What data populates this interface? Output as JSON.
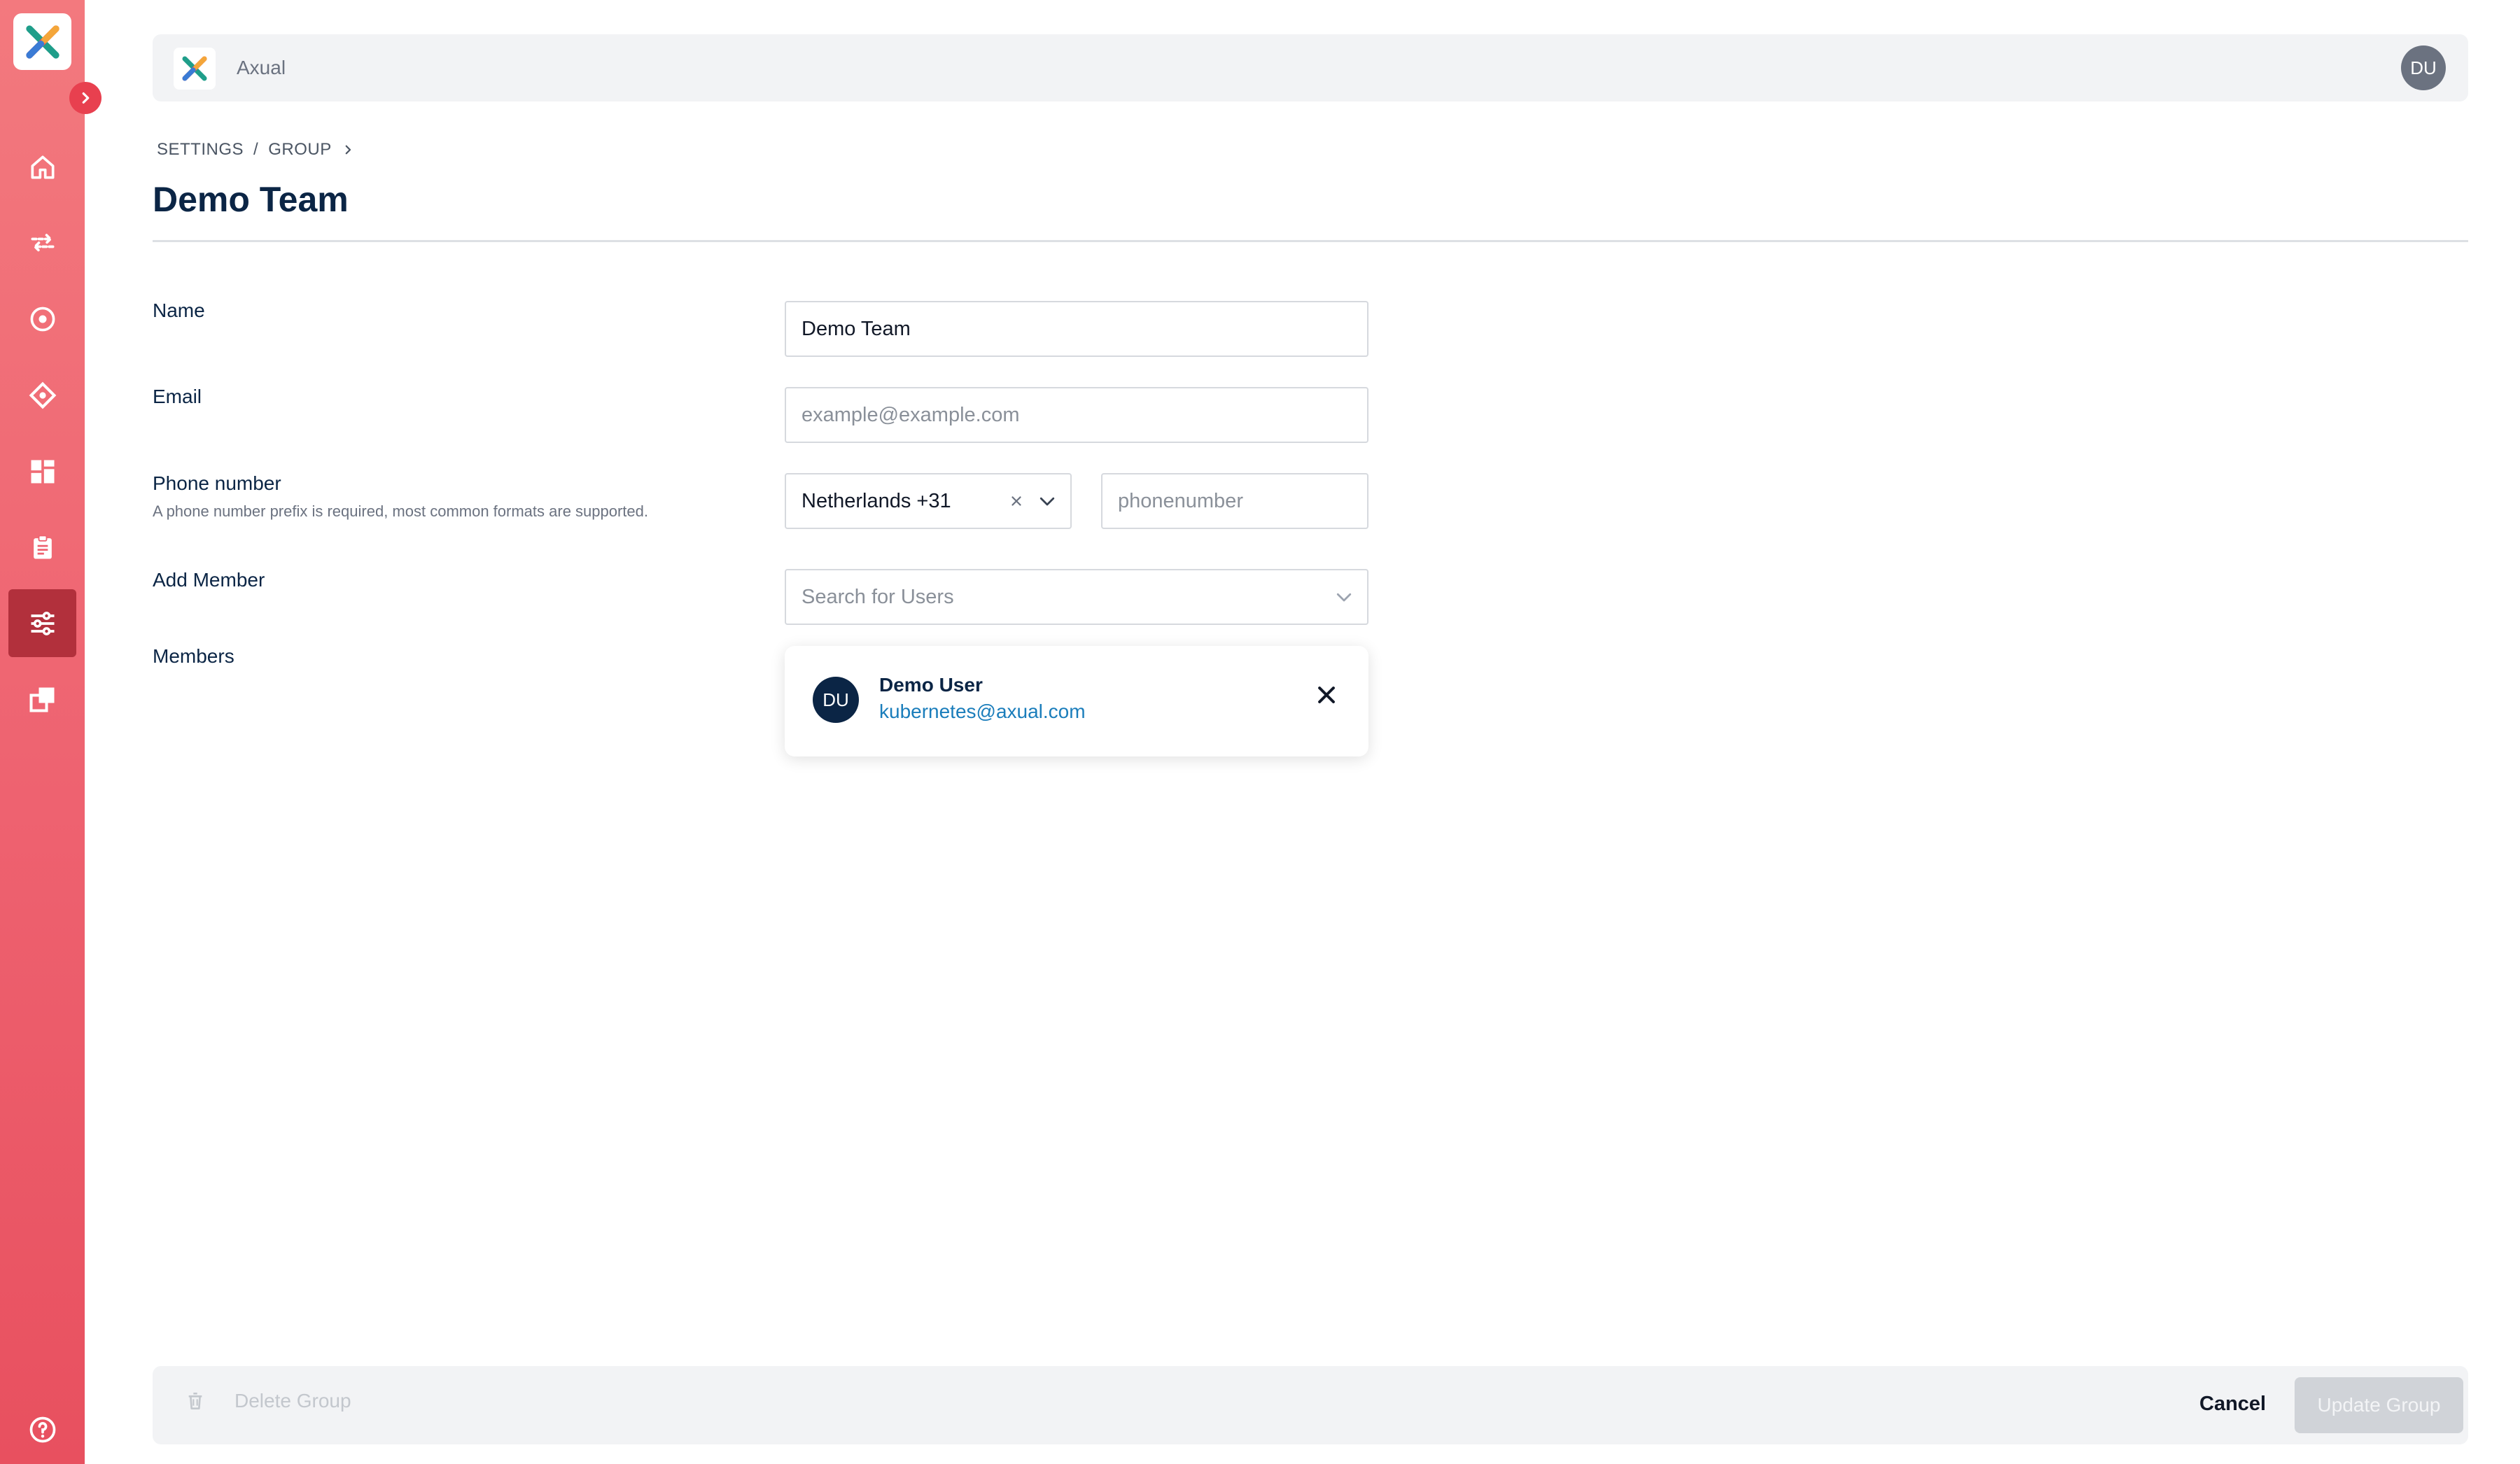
{
  "app": {
    "name": "Axual",
    "user_initials": "DU"
  },
  "breadcrumb": {
    "items": [
      "SETTINGS",
      "GROUP"
    ],
    "separator": "/"
  },
  "page": {
    "title": "Demo Team"
  },
  "form": {
    "name": {
      "label": "Name",
      "value": "Demo Team"
    },
    "email": {
      "label": "Email",
      "placeholder": "example@example.com"
    },
    "phone": {
      "label": "Phone number",
      "hint": "A phone number prefix is required, most common formats are supported.",
      "country_value": "Netherlands +31",
      "number_placeholder": "phonenumber"
    },
    "add_member": {
      "label": "Add Member",
      "placeholder": "Search for Users"
    },
    "members": {
      "label": "Members",
      "items": [
        {
          "initials": "DU",
          "name": "Demo User",
          "email": "kubernetes@axual.com"
        }
      ]
    }
  },
  "footer": {
    "delete_label": "Delete Group",
    "cancel_label": "Cancel",
    "update_label": "Update Group"
  },
  "sidebar": {
    "items": [
      {
        "icon": "home-icon"
      },
      {
        "icon": "streams-icon"
      },
      {
        "icon": "target-icon"
      },
      {
        "icon": "diamond-icon"
      },
      {
        "icon": "grid-icon"
      },
      {
        "icon": "clipboard-icon"
      },
      {
        "icon": "settings-sliders-icon",
        "active": true
      },
      {
        "icon": "copy-icon"
      }
    ],
    "help_icon": "help-icon"
  },
  "colors": {
    "brand": "#ee6270",
    "active": "#b2303c",
    "link": "#1a7dbb",
    "title": "#0b2545"
  }
}
